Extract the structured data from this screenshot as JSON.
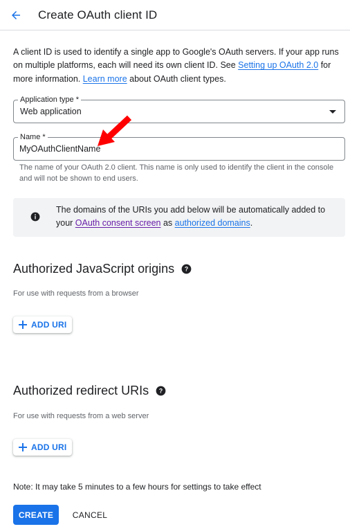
{
  "header": {
    "back_icon": "arrow-back-icon",
    "title": "Create OAuth client ID"
  },
  "intro": {
    "text_1": "A client ID is used to identify a single app to Google's OAuth servers. If your app runs on multiple platforms, each will need its own client ID. See ",
    "link_setup": "Setting up OAuth 2.0",
    "text_2": " for more information. ",
    "link_learn": "Learn more",
    "text_3": " about OAuth client types."
  },
  "application_type": {
    "label": "Application type *",
    "value": "Web application"
  },
  "name": {
    "label": "Name *",
    "value": "MyOAuthClientName",
    "helper": "The name of your OAuth 2.0 client. This name is only used to identify the client in the console and will not be shown to end users."
  },
  "info_box": {
    "icon": "info-icon",
    "text_1": "The domains of the URIs you add below will be automatically added to your ",
    "link_consent": "OAuth consent screen",
    "text_2": " as ",
    "link_domains": "authorized domains",
    "text_3": "."
  },
  "js_origins": {
    "title": "Authorized JavaScript origins",
    "subtitle": "For use with requests from a browser",
    "add_label": "ADD URI"
  },
  "redirect_uris": {
    "title": "Authorized redirect URIs",
    "subtitle": "For use with requests from a web server",
    "add_label": "ADD URI"
  },
  "note": "Note: It may take 5 minutes to a few hours for settings to take effect",
  "actions": {
    "create": "CREATE",
    "cancel": "CANCEL"
  },
  "colors": {
    "accent": "#1a73e8",
    "visited_link": "#681da8",
    "annotation_arrow": "#ff0000",
    "info_bg": "#f1f3f4"
  }
}
